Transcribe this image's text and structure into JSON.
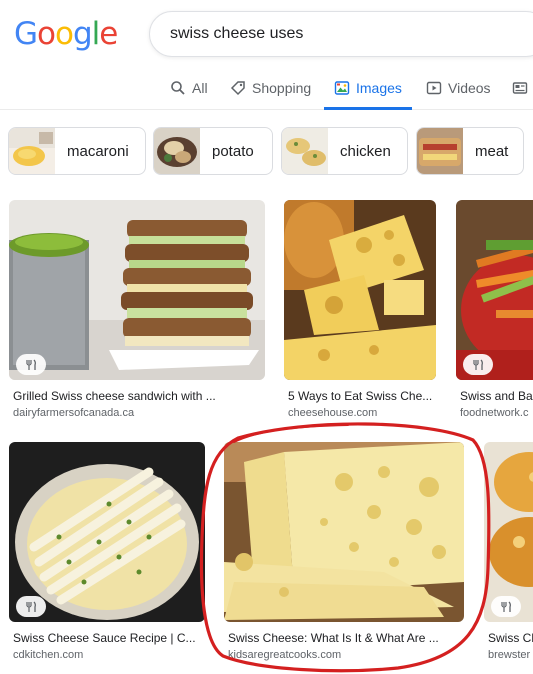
{
  "logo": {
    "letters": [
      "G",
      "o",
      "o",
      "g",
      "l",
      "e"
    ],
    "colors": [
      "#4285F4",
      "#EA4335",
      "#FBBC05",
      "#4285F4",
      "#34A853",
      "#EA4335"
    ]
  },
  "search": {
    "query": "swiss cheese uses"
  },
  "tabs": [
    {
      "label": "All",
      "icon": "search-icon"
    },
    {
      "label": "Shopping",
      "icon": "tag-icon"
    },
    {
      "label": "Images",
      "icon": "image-icon",
      "active": true
    },
    {
      "label": "Videos",
      "icon": "play-icon"
    },
    {
      "label": "",
      "icon": "news-icon"
    }
  ],
  "chips": [
    {
      "label": "macaroni"
    },
    {
      "label": "potato"
    },
    {
      "label": "chicken"
    },
    {
      "label": "meat"
    }
  ],
  "results": [
    {
      "title": "Grilled Swiss cheese sandwich with ...",
      "source": "dairyfarmersofcanada.ca",
      "badge": "recipe-icon"
    },
    {
      "title": "5 Ways to Eat Swiss Che...",
      "source": "cheesehouse.com",
      "badge": ""
    },
    {
      "title": "Swiss and Ba",
      "source": "foodnetwork.c",
      "badge": "recipe-icon"
    },
    {
      "title": "Swiss Cheese Sauce Recipe | C...",
      "source": "cdkitchen.com",
      "badge": "recipe-icon"
    },
    {
      "title": "Swiss Cheese: What Is It & What Are ...",
      "source": "kidsaregreatcooks.com",
      "badge": ""
    },
    {
      "title": "Swiss Ch",
      "source": "brewster",
      "badge": "recipe-icon"
    }
  ],
  "colors": {
    "accent": "#1a73e8",
    "annotation": "#d42020"
  }
}
